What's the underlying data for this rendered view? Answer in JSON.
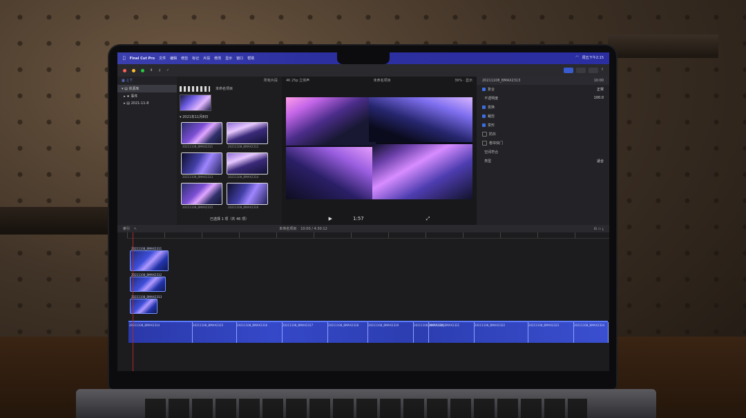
{
  "menubar": {
    "app_name": "Final Cut Pro",
    "items": [
      "文件",
      "编辑",
      "修剪",
      "标记",
      "片段",
      "修改",
      "显示",
      "窗口",
      "帮助"
    ],
    "status": "周五下午2:15"
  },
  "library": {
    "items": [
      "资源库",
      "事件",
      "2021-11-8"
    ]
  },
  "browser": {
    "filter": "所有片段",
    "project_title": "未命名项目",
    "date_header": "2021年11月8日",
    "clip_labels": [
      "20211108_BMAX2311",
      "20211108_BMAX2312",
      "20211108_BMAX2313",
      "20211108_BMAX2314",
      "20211108_BMAX2315",
      "20211108_BMAX2316"
    ],
    "footer": "已选择 1 项（共 46 项）"
  },
  "viewer": {
    "format": "4K 25p 立体声",
    "project": "未命名项目",
    "zoom": "39%",
    "view_menu": "显示",
    "timecode": "1:57"
  },
  "inspector": {
    "clip_name": "20211108_BMAX2313",
    "duration": "10:00",
    "rows": [
      {
        "label": "复合",
        "value": "正常"
      },
      {
        "label": "不透明度",
        "value": "100.0"
      },
      {
        "label": "变换",
        "value": ""
      },
      {
        "label": "裁剪",
        "value": ""
      },
      {
        "label": "变形",
        "value": ""
      },
      {
        "label": "防抖",
        "value": ""
      },
      {
        "label": "卷帘快门",
        "value": ""
      },
      {
        "label": "空间符合",
        "value": ""
      },
      {
        "label": "类型",
        "value": "适合"
      }
    ]
  },
  "timeline": {
    "index": "索引",
    "project_name": "未命名项目",
    "duration": "10:00 / 4:30:12",
    "connected_clips": [
      "20211108_BMAX2311",
      "20211108_BMAX2312",
      "20211108_BMAX2313"
    ],
    "storyline_clips": [
      "20211108_BMAX2314",
      "20211108_BMAX2315",
      "20211108_BMAX2316",
      "20211108_BMAX2317",
      "20211108_BMAX2318",
      "20211108_BMAX2319",
      "20211108_BMAX2320",
      "20211108_BMAX2321",
      "20211108_BMAX2322",
      "20211108_BMAX2323",
      "20211108_BMAX2324",
      "20211108_BMAX2325"
    ]
  },
  "colors": {
    "menubar": "#2c2fa0",
    "clip_blue": "#3f4fd9",
    "accent": "#7a95ff",
    "playhead": "#b02a2a"
  }
}
